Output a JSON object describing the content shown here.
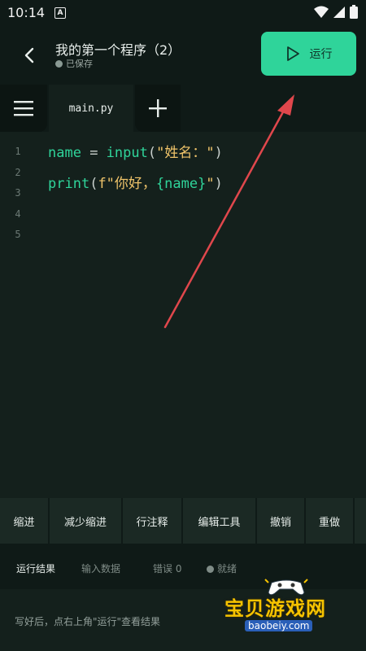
{
  "status": {
    "time": "10:14",
    "app_glyph": "A"
  },
  "header": {
    "title": "我的第一个程序（2）",
    "saved_text": "已保存",
    "run_label": "运行"
  },
  "tabs": {
    "file_name": "main.py"
  },
  "editor": {
    "line_numbers": [
      "1",
      "2",
      "3",
      "4",
      "5"
    ],
    "line1": {
      "var": "name",
      "op": " = ",
      "fn": "input",
      "open": "(",
      "str": "\"姓名：\"",
      "close": ")"
    },
    "line2": {
      "fn": "print",
      "open": "(",
      "str_a": "f\"你好，",
      "interp": "{name}",
      "str_b": "\"",
      "close": ")"
    }
  },
  "toolbar": [
    "缩进",
    "减少缩进",
    "行注释",
    "编辑工具",
    "撤销",
    "重做"
  ],
  "output": {
    "tab_result": "运行结果",
    "tab_input": "输入数据",
    "tab_error": "错误 0",
    "tab_status": "就绪",
    "hint": "写好后，点右上角\"运行\"查看结果"
  },
  "watermark": {
    "title": "宝贝游戏网",
    "url": "baobeiy.com"
  },
  "colors": {
    "accent": "#2fd49a",
    "annotation_arrow": "#e0474c",
    "background": "#0f1a17"
  }
}
